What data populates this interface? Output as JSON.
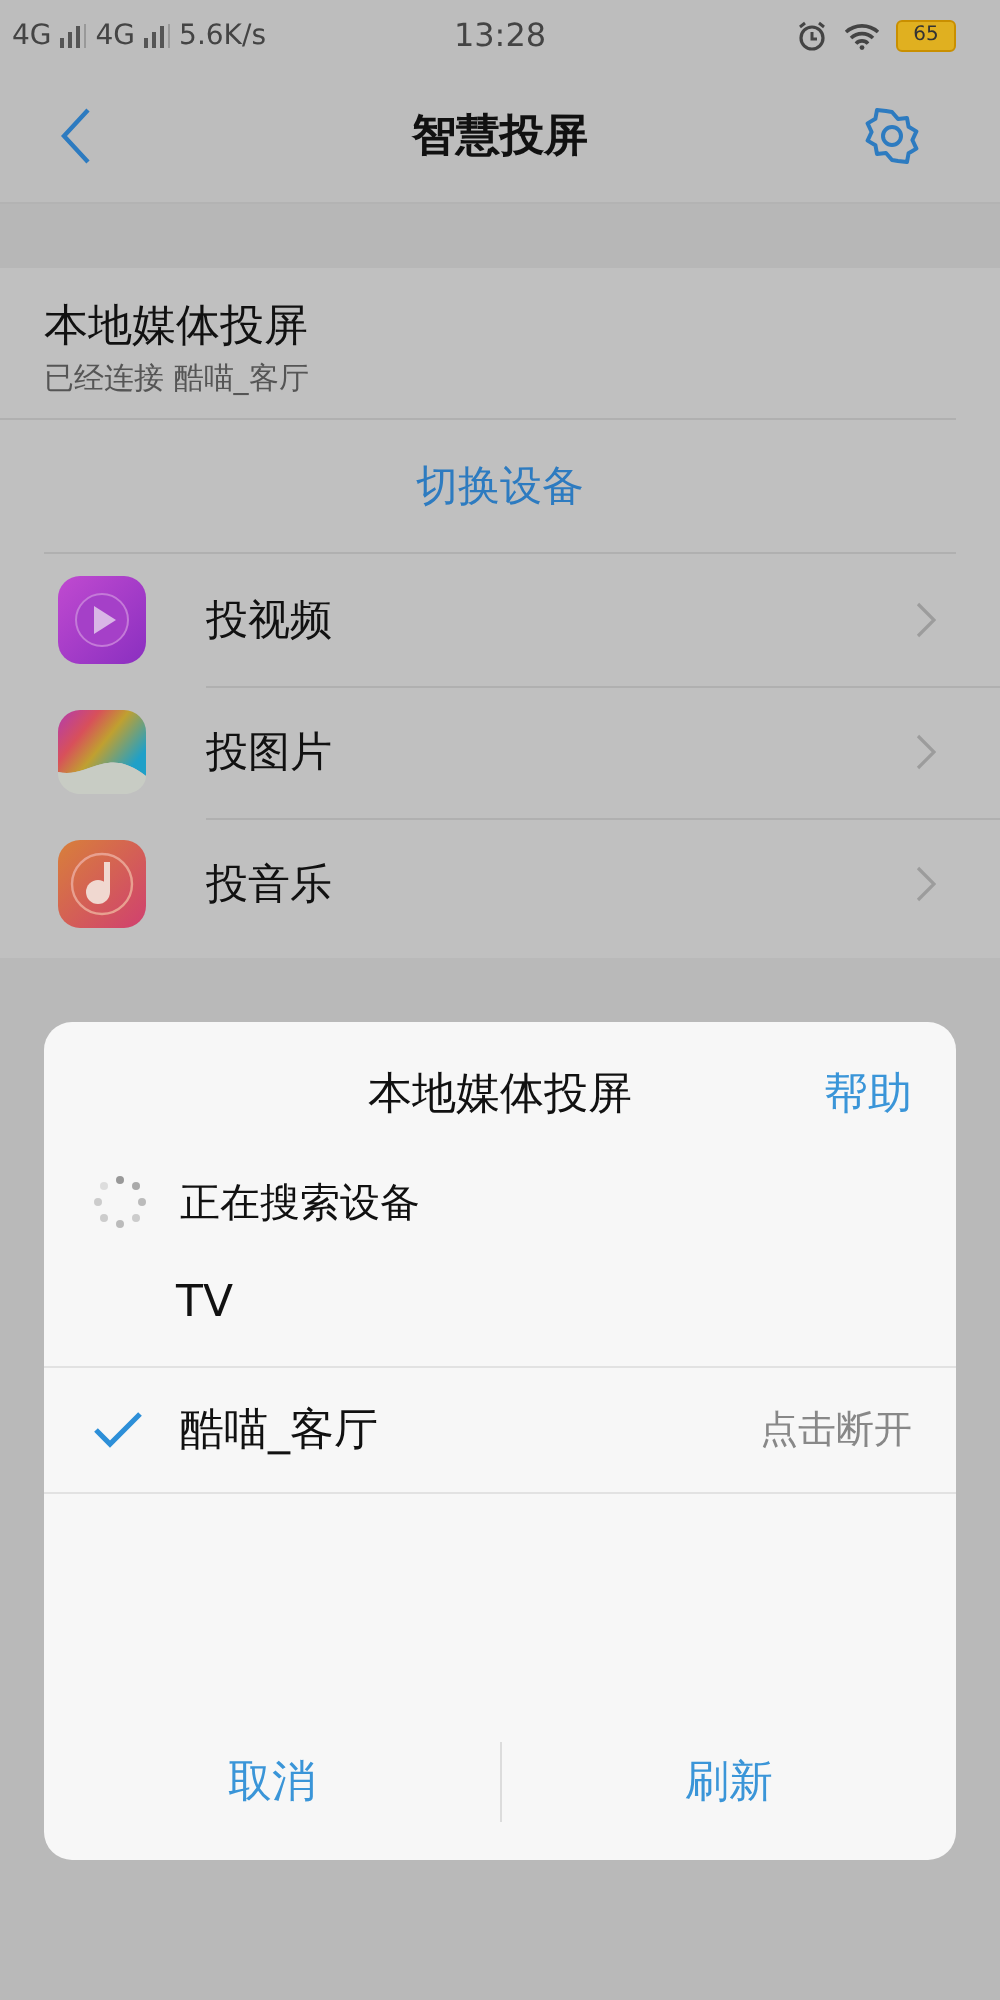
{
  "status_bar": {
    "signals": [
      "4G",
      "4G"
    ],
    "speed": "5.6K/s",
    "time": "13:28",
    "battery": "65"
  },
  "nav": {
    "title": "智慧投屏"
  },
  "section": {
    "title": "本地媒体投屏",
    "subtitle": "已经连接 酷喵_客厅",
    "switch_label": "切换设备",
    "items": [
      {
        "kind": "video",
        "label": "投视频"
      },
      {
        "kind": "photo",
        "label": "投图片"
      },
      {
        "kind": "music",
        "label": "投音乐"
      }
    ]
  },
  "dialog": {
    "title": "本地媒体投屏",
    "help": "帮助",
    "status": "正在搜索设备",
    "group_label": "TV",
    "devices": [
      {
        "name": "酷喵_客厅",
        "selected": true,
        "action": "点击断开"
      }
    ],
    "buttons": [
      "取消",
      "刷新"
    ]
  }
}
